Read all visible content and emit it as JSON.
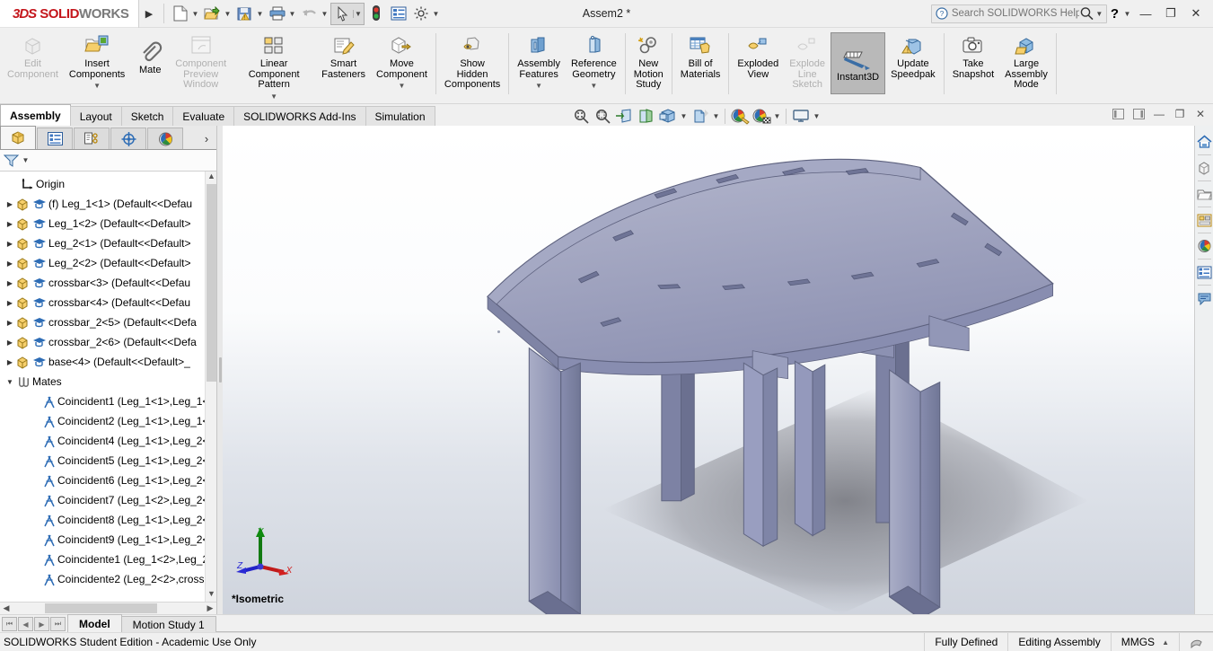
{
  "titlebar": {
    "logo_3ds": "3DS",
    "logo_solid": "SOLID",
    "logo_works": "WORKS",
    "document_title": "Assem2 *",
    "search_placeholder": "Search SOLIDWORKS Help",
    "quick_access": [
      {
        "name": "new-document",
        "dropdown": true
      },
      {
        "name": "open-document",
        "dropdown": true
      },
      {
        "name": "save",
        "dropdown": true
      },
      {
        "name": "print",
        "dropdown": true
      },
      {
        "name": "undo",
        "dropdown": true
      },
      {
        "name": "select",
        "dropdown": true
      },
      {
        "name": "rebuild",
        "dropdown": false
      },
      {
        "name": "file-properties",
        "dropdown": false
      },
      {
        "name": "options",
        "dropdown": true
      }
    ],
    "window_buttons": [
      "minimize",
      "restore",
      "close"
    ]
  },
  "ribbon": {
    "commands": [
      {
        "label": "Edit\nComponent",
        "icon": "edit-component",
        "disabled": true,
        "dropdown": false,
        "selected": false
      },
      {
        "label": "Insert\nComponents",
        "icon": "insert-components",
        "disabled": false,
        "dropdown": true,
        "selected": false
      },
      {
        "label": "Mate",
        "icon": "mate",
        "disabled": false,
        "dropdown": false,
        "selected": false
      },
      {
        "label": "Component\nPreview\nWindow",
        "icon": "component-preview-window",
        "disabled": true,
        "dropdown": false,
        "selected": false
      },
      {
        "label": "Linear Component\nPattern",
        "icon": "linear-component-pattern",
        "disabled": false,
        "dropdown": true,
        "selected": false
      },
      {
        "label": "Smart\nFasteners",
        "icon": "smart-fasteners",
        "disabled": false,
        "dropdown": false,
        "selected": false
      },
      {
        "label": "Move\nComponent",
        "icon": "move-component",
        "disabled": false,
        "dropdown": true,
        "selected": false
      },
      {
        "sep": true
      },
      {
        "label": "Show\nHidden\nComponents",
        "icon": "show-hidden-components",
        "disabled": false,
        "dropdown": false,
        "selected": false
      },
      {
        "sep": true
      },
      {
        "label": "Assembly\nFeatures",
        "icon": "assembly-features",
        "disabled": false,
        "dropdown": true,
        "selected": false
      },
      {
        "label": "Reference\nGeometry",
        "icon": "reference-geometry",
        "disabled": false,
        "dropdown": true,
        "selected": false
      },
      {
        "sep": true
      },
      {
        "label": "New\nMotion\nStudy",
        "icon": "new-motion-study",
        "disabled": false,
        "dropdown": false,
        "selected": false
      },
      {
        "sep": true
      },
      {
        "label": "Bill of\nMaterials",
        "icon": "bill-of-materials",
        "disabled": false,
        "dropdown": false,
        "selected": false
      },
      {
        "sep": true
      },
      {
        "label": "Exploded\nView",
        "icon": "exploded-view",
        "disabled": false,
        "dropdown": false,
        "selected": false
      },
      {
        "label": "Explode\nLine\nSketch",
        "icon": "explode-line-sketch",
        "disabled": true,
        "dropdown": false,
        "selected": false
      },
      {
        "label": "Instant3D",
        "icon": "instant3d",
        "disabled": false,
        "dropdown": false,
        "selected": true
      },
      {
        "label": "Update\nSpeedpak",
        "icon": "update-speedpak",
        "disabled": false,
        "dropdown": false,
        "selected": false
      },
      {
        "sep": true
      },
      {
        "label": "Take\nSnapshot",
        "icon": "take-snapshot",
        "disabled": false,
        "dropdown": false,
        "selected": false
      },
      {
        "label": "Large\nAssembly\nMode",
        "icon": "large-assembly-mode",
        "disabled": false,
        "dropdown": false,
        "selected": false
      },
      {
        "sep": true
      }
    ]
  },
  "tabs": [
    {
      "label": "Assembly",
      "active": true
    },
    {
      "label": "Layout",
      "active": false
    },
    {
      "label": "Sketch",
      "active": false
    },
    {
      "label": "Evaluate",
      "active": false
    },
    {
      "label": "SOLIDWORKS Add-Ins",
      "active": false
    },
    {
      "label": "Simulation",
      "active": false
    }
  ],
  "view_toolbar": [
    {
      "name": "zoom-to-fit-icon"
    },
    {
      "name": "zoom-to-area-icon"
    },
    {
      "name": "section-view-icon"
    },
    {
      "name": "view-orientation-icon"
    },
    {
      "name": "display-style-icon",
      "dropdown": true
    },
    {
      "name": "hide-show-items-icon",
      "dropdown": true
    },
    {
      "name": "edit-appearance-icon"
    },
    {
      "name": "apply-scene-icon",
      "dropdown": true
    },
    {
      "name": "view-settings-icon",
      "dropdown": true
    }
  ],
  "feature_manager": {
    "tabs": [
      {
        "name": "feature-manager-design-tree",
        "active": true
      },
      {
        "name": "property-manager",
        "active": false
      },
      {
        "name": "configuration-manager",
        "active": false
      },
      {
        "name": "dimxpert-manager",
        "active": false
      },
      {
        "name": "display-manager",
        "active": false
      }
    ],
    "filter_placeholder": "",
    "tree": [
      {
        "label": "Origin",
        "icon": "origin-icon",
        "twist": "",
        "indent": 1
      },
      {
        "label": "(f) Leg_1<1> (Default<<Defau",
        "icon": "component-icon",
        "twist": "collapsed",
        "indent": 0
      },
      {
        "label": "Leg_1<2> (Default<<Default>",
        "icon": "component-icon",
        "twist": "collapsed",
        "indent": 0
      },
      {
        "label": "Leg_2<1> (Default<<Default>",
        "icon": "component-icon",
        "twist": "collapsed",
        "indent": 0
      },
      {
        "label": "Leg_2<2> (Default<<Default>",
        "icon": "component-icon",
        "twist": "collapsed",
        "indent": 0
      },
      {
        "label": "crossbar<3> (Default<<Defau",
        "icon": "component-icon",
        "twist": "collapsed",
        "indent": 0
      },
      {
        "label": "crossbar<4> (Default<<Defau",
        "icon": "component-icon",
        "twist": "collapsed",
        "indent": 0
      },
      {
        "label": "crossbar_2<5> (Default<<Defa",
        "icon": "component-icon",
        "twist": "collapsed",
        "indent": 0
      },
      {
        "label": "crossbar_2<6> (Default<<Defa",
        "icon": "component-icon",
        "twist": "collapsed",
        "indent": 0
      },
      {
        "label": "base<4> (Default<<Default>_",
        "icon": "component-icon",
        "twist": "collapsed",
        "indent": 0
      },
      {
        "label": "Mates",
        "icon": "mates-folder-icon",
        "twist": "expanded",
        "indent": 0
      },
      {
        "label": "Coincident1 (Leg_1<1>,Leg_1<",
        "icon": "coincident-mate-icon",
        "twist": "",
        "indent": 2
      },
      {
        "label": "Coincident2 (Leg_1<1>,Leg_1<",
        "icon": "coincident-mate-icon",
        "twist": "",
        "indent": 2
      },
      {
        "label": "Coincident4 (Leg_1<1>,Leg_2<",
        "icon": "coincident-mate-icon",
        "twist": "",
        "indent": 2
      },
      {
        "label": "Coincident5 (Leg_1<1>,Leg_2<",
        "icon": "coincident-mate-icon",
        "twist": "",
        "indent": 2
      },
      {
        "label": "Coincident6 (Leg_1<1>,Leg_2<",
        "icon": "coincident-mate-icon",
        "twist": "",
        "indent": 2
      },
      {
        "label": "Coincident7 (Leg_1<2>,Leg_2<",
        "icon": "coincident-mate-icon",
        "twist": "",
        "indent": 2
      },
      {
        "label": "Coincident8 (Leg_1<1>,Leg_2<",
        "icon": "coincident-mate-icon",
        "twist": "",
        "indent": 2
      },
      {
        "label": "Coincident9 (Leg_1<1>,Leg_2<",
        "icon": "coincident-mate-icon",
        "twist": "",
        "indent": 2
      },
      {
        "label": "Coincidente1 (Leg_1<2>,Leg_2",
        "icon": "coincident-mate-icon",
        "twist": "",
        "indent": 2
      },
      {
        "label": "Coincidente2 (Leg_2<2>,cross",
        "icon": "coincident-mate-icon",
        "twist": "",
        "indent": 2
      }
    ]
  },
  "graphics": {
    "view_label": "*Isometric",
    "triad": {
      "x": "X",
      "y": "Y",
      "z": "Z"
    },
    "model_color": "#9fa3c0",
    "background_top": "#ffffff",
    "background_bottom": "#cfd4dd"
  },
  "task_pane": [
    {
      "name": "solidworks-resources-icon"
    },
    {
      "name": "design-library-icon"
    },
    {
      "name": "file-explorer-icon"
    },
    {
      "name": "view-palette-icon"
    },
    {
      "name": "appearances-scenes-decals-icon"
    },
    {
      "name": "custom-properties-icon"
    },
    {
      "name": "solidworks-forum-icon"
    }
  ],
  "bottom_tabs": [
    {
      "label": "Model",
      "active": true
    },
    {
      "label": "Motion Study 1",
      "active": false
    }
  ],
  "statusbar": {
    "left_text": "SOLIDWORKS Student Edition - Academic Use Only",
    "state": "Fully Defined",
    "edit_mode": "Editing Assembly",
    "units": "MMGS"
  }
}
